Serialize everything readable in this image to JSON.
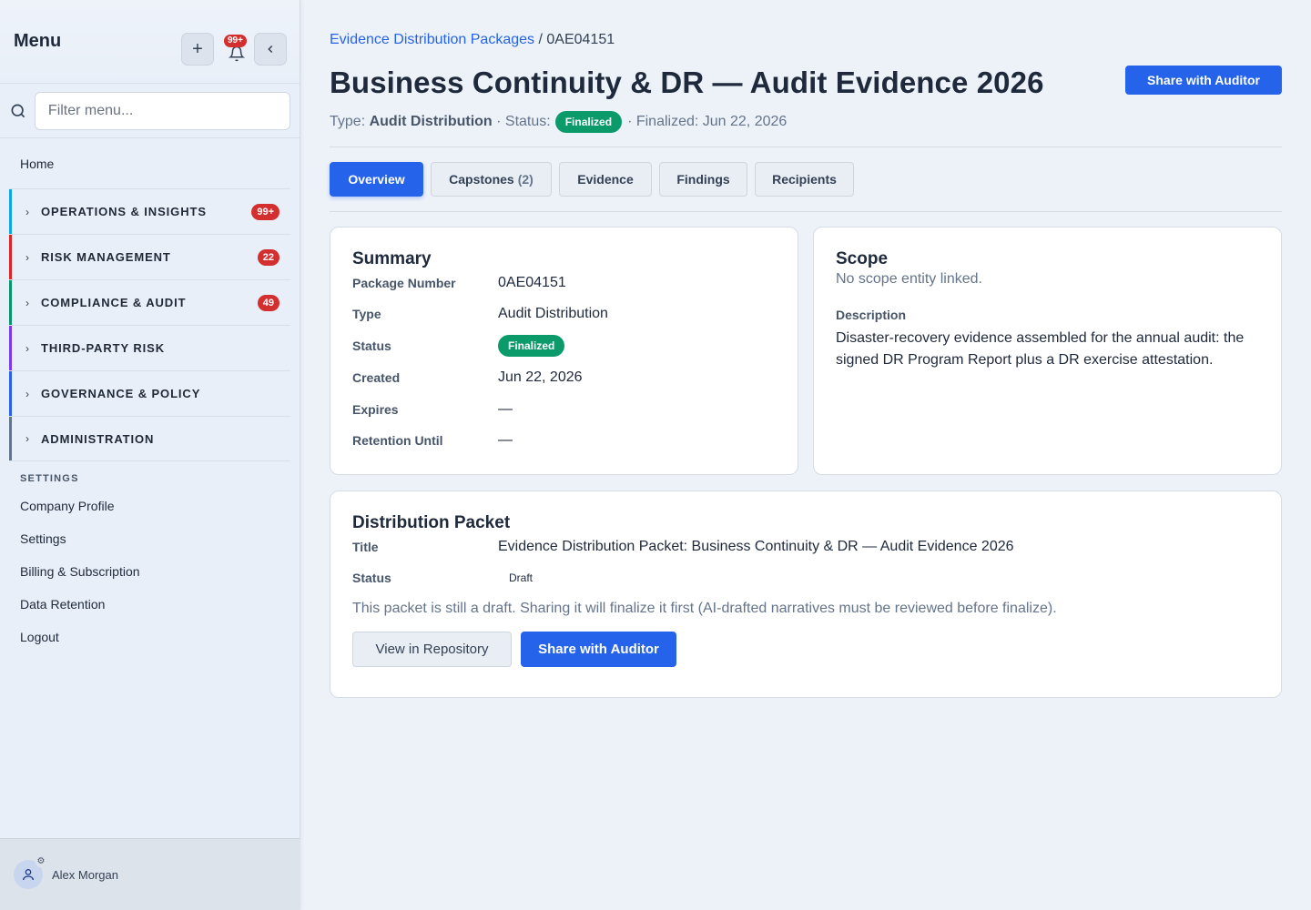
{
  "sidebar": {
    "title": "Menu",
    "notification_count": "99+",
    "filter_placeholder": "Filter menu...",
    "home": "Home",
    "groups": [
      {
        "label": "OPERATIONS & INSIGHTS",
        "badge": "99+",
        "color": "#0ea5e9"
      },
      {
        "label": "RISK MANAGEMENT",
        "badge": "22",
        "color": "#dc2626"
      },
      {
        "label": "COMPLIANCE & AUDIT",
        "badge": "49",
        "color": "#059669"
      },
      {
        "label": "THIRD-PARTY RISK",
        "badge": "",
        "color": "#7c3aed"
      },
      {
        "label": "GOVERNANCE & POLICY",
        "badge": "",
        "color": "#2563eb"
      },
      {
        "label": "ADMINISTRATION",
        "badge": "",
        "color": "#64748b"
      }
    ],
    "settings_label": "SETTINGS",
    "settings_links": [
      "Company Profile",
      "Settings",
      "Billing & Subscription",
      "Data Retention",
      "Logout"
    ],
    "user_name": "Alex Morgan"
  },
  "breadcrumb": {
    "parent": "Evidence Distribution Packages",
    "separator": "/",
    "current": "0AE04151"
  },
  "header": {
    "title": "Business Continuity & DR — Audit Evidence 2026",
    "share_button": "Share with Auditor",
    "type_label": "Type:",
    "type_value": "Audit Distribution",
    "status_label": "· Status:",
    "status_value": "Finalized",
    "finalized_text": "· Finalized: Jun 22, 2026"
  },
  "tabs": [
    {
      "label": "Overview",
      "count": ""
    },
    {
      "label": "Capstones",
      "count": "(2)"
    },
    {
      "label": "Evidence",
      "count": ""
    },
    {
      "label": "Findings",
      "count": ""
    },
    {
      "label": "Recipients",
      "count": ""
    }
  ],
  "summary": {
    "title": "Summary",
    "rows": [
      {
        "k": "Package Number",
        "v": "0AE04151"
      },
      {
        "k": "Type",
        "v": "Audit Distribution"
      },
      {
        "k": "Status",
        "v": "Finalized"
      },
      {
        "k": "Created",
        "v": "Jun 22, 2026"
      },
      {
        "k": "Expires",
        "v": "—"
      },
      {
        "k": "Retention Until",
        "v": "—"
      }
    ]
  },
  "scope": {
    "title": "Scope",
    "empty": "No scope entity linked.",
    "description_label": "Description",
    "description": "Disaster-recovery evidence assembled for the annual audit: the signed DR Program Report plus a DR exercise attestation."
  },
  "packet": {
    "title": "Distribution Packet",
    "title_label": "Title",
    "title_value": "Evidence Distribution Packet: Business Continuity & DR — Audit Evidence 2026",
    "status_label": "Status",
    "status_value": "Draft",
    "note": "This packet is still a draft. Sharing it will finalize it first (AI-drafted narratives must be reviewed before finalize).",
    "view_button": "View in Repository",
    "share_button": "Share with Auditor"
  }
}
